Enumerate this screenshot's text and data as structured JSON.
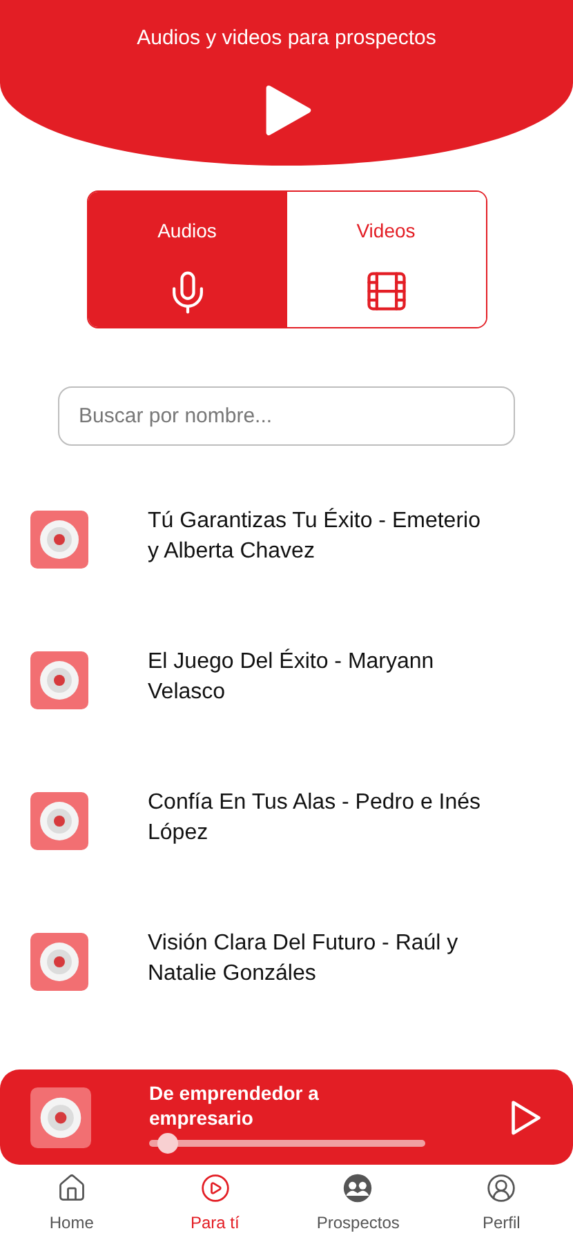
{
  "header": {
    "title": "Audios y videos para prospectos"
  },
  "tabs": [
    {
      "label": "Audios",
      "kind": "audio",
      "selected": true
    },
    {
      "label": "Videos",
      "kind": "video",
      "selected": false
    }
  ],
  "search": {
    "placeholder": "Buscar por nombre..."
  },
  "items": [
    {
      "title": "Tú Garantizas Tu Éxito - Emeterio y Alberta Chavez"
    },
    {
      "title": "El Juego Del Éxito - Maryann Velasco"
    },
    {
      "title": "Confía En Tus Alas - Pedro e Inés López"
    },
    {
      "title": "Visión Clara Del Futuro - Raúl y Natalie Gonzáles"
    }
  ],
  "player": {
    "title": "De emprendedor a empresario",
    "level": 0.03
  },
  "nav": [
    {
      "label": "Home",
      "kind": "home",
      "selected": false
    },
    {
      "label": "Para tí",
      "kind": "play",
      "selected": true
    },
    {
      "label": "Prospectos",
      "kind": "people",
      "selected": false
    },
    {
      "label": "Perfil",
      "kind": "profile",
      "selected": false
    }
  ]
}
